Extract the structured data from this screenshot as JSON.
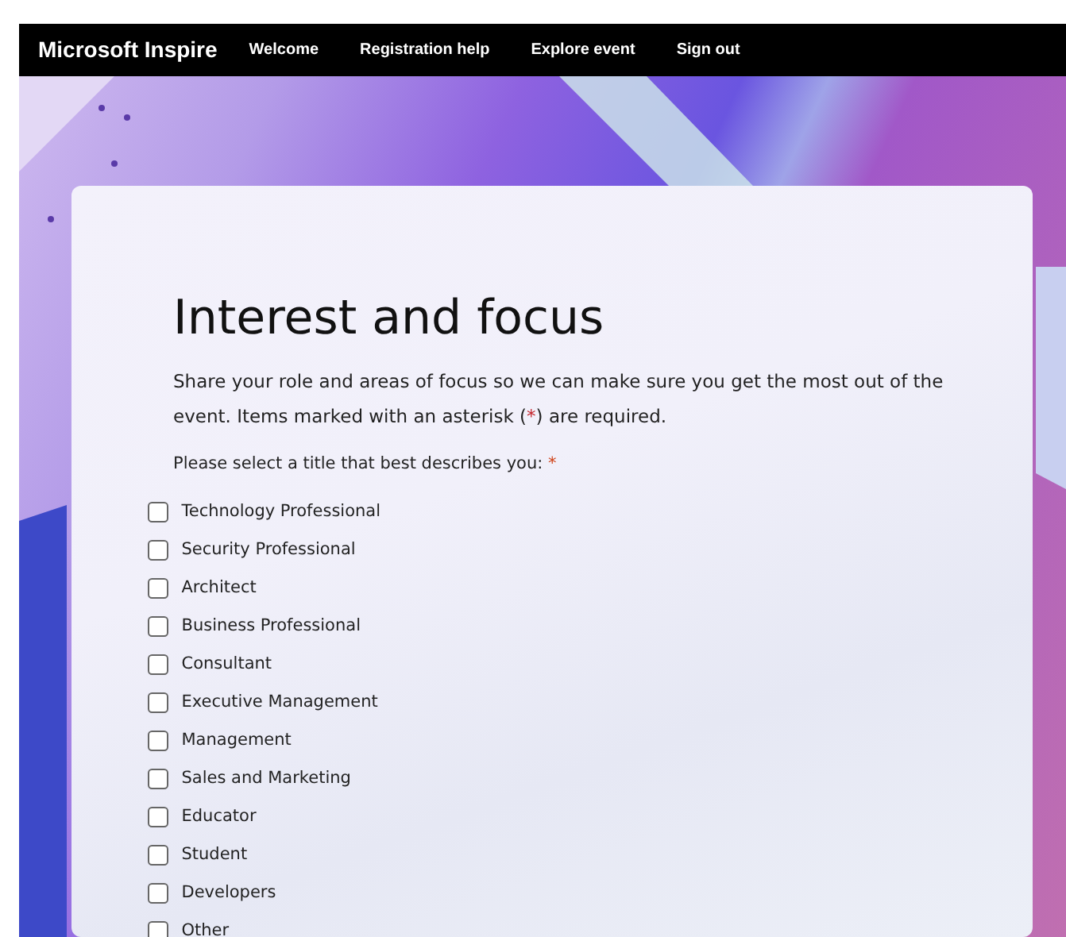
{
  "navbar": {
    "brand": "Microsoft Inspire",
    "links": [
      {
        "label": "Welcome"
      },
      {
        "label": "Registration help"
      },
      {
        "label": "Explore event"
      },
      {
        "label": "Sign out"
      }
    ]
  },
  "form": {
    "title": "Interest and focus",
    "description": {
      "before": "Share your role and areas of focus so we can make sure you get the most out of the event. Items marked with an asterisk (",
      "marker": "*",
      "after": ") are required."
    },
    "question": {
      "label": "Please select a title that best describes you:",
      "required_mark": "*"
    },
    "options": [
      {
        "label": "Technology Professional",
        "checked": false
      },
      {
        "label": "Security Professional",
        "checked": false
      },
      {
        "label": "Architect",
        "checked": false
      },
      {
        "label": "Business Professional",
        "checked": false
      },
      {
        "label": "Consultant",
        "checked": false
      },
      {
        "label": "Executive Management",
        "checked": false
      },
      {
        "label": "Management",
        "checked": false
      },
      {
        "label": "Sales and Marketing",
        "checked": false
      },
      {
        "label": "Educator",
        "checked": false
      },
      {
        "label": "Student",
        "checked": false
      },
      {
        "label": "Developers",
        "checked": false
      },
      {
        "label": "Other",
        "checked": false
      }
    ]
  }
}
